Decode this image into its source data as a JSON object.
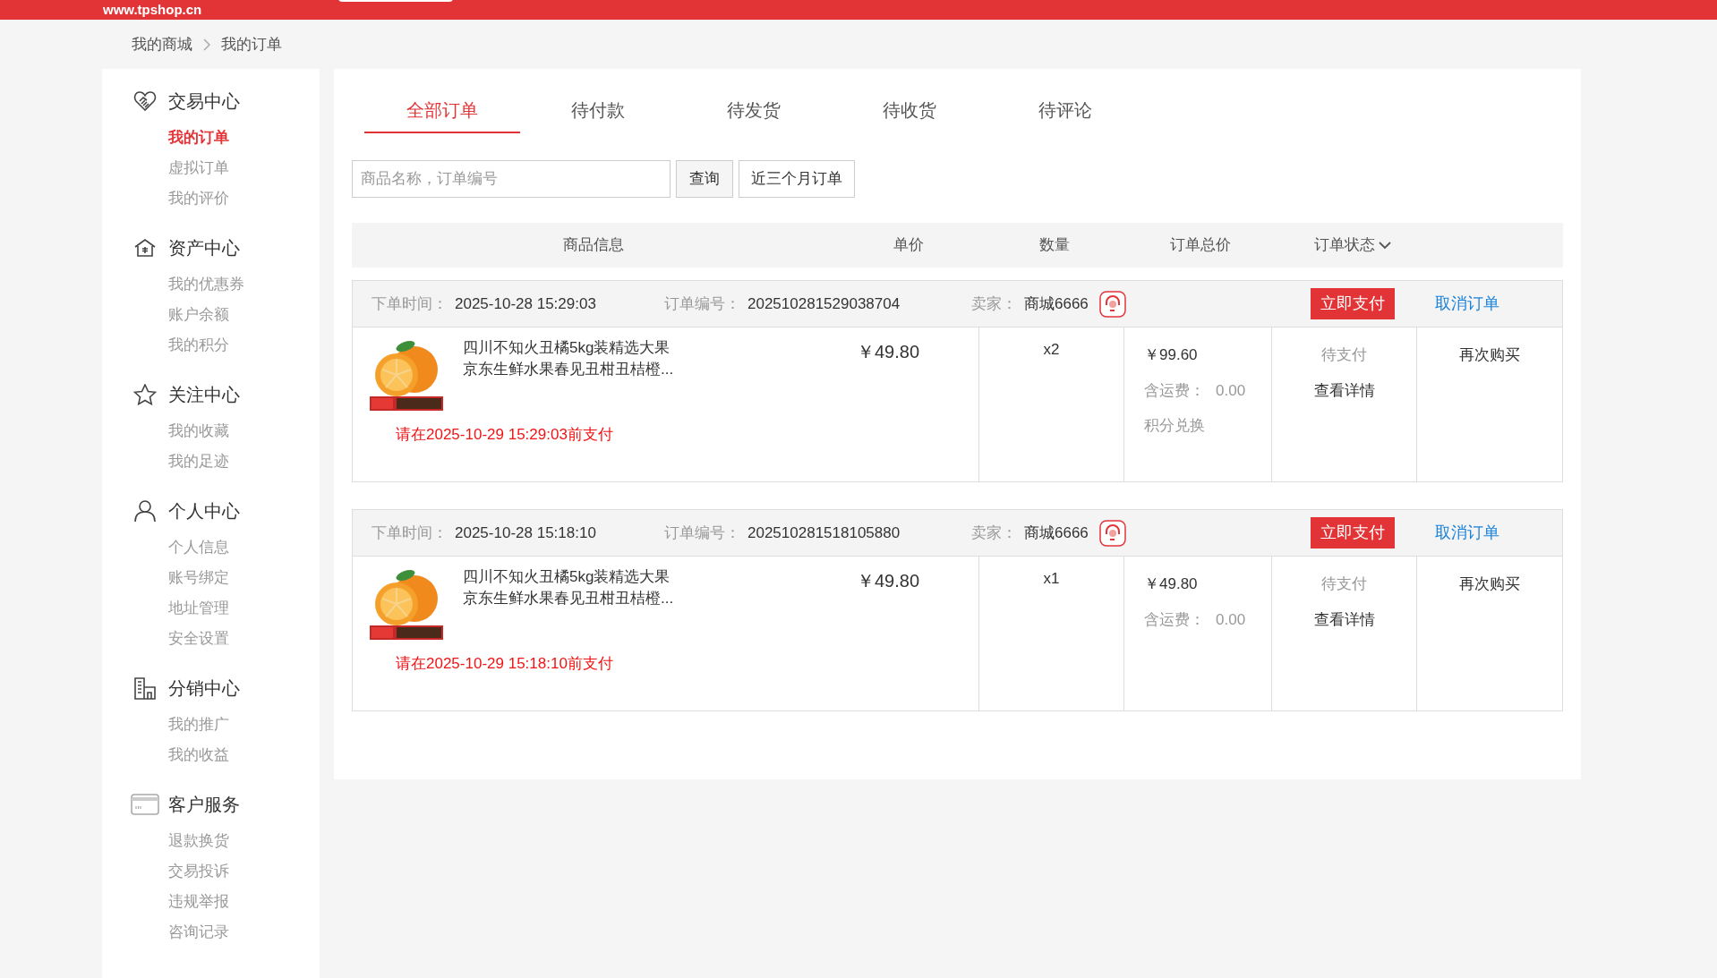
{
  "header": {
    "logo": "www.tpshop.cn"
  },
  "breadcrumb": [
    "我的商城",
    "我的订单"
  ],
  "sidebar": [
    {
      "title": "交易中心",
      "kind": "handshake",
      "items": [
        {
          "label": "我的订单",
          "selected": true
        },
        {
          "label": "虚拟订单",
          "selected": false
        },
        {
          "label": "我的评价",
          "selected": false
        }
      ]
    },
    {
      "title": "资产中心",
      "kind": "house",
      "items": [
        {
          "label": "我的优惠券",
          "selected": false
        },
        {
          "label": "账户余额",
          "selected": false
        },
        {
          "label": "我的积分",
          "selected": false
        }
      ]
    },
    {
      "title": "关注中心",
      "kind": "star",
      "items": [
        {
          "label": "我的收藏",
          "selected": false
        },
        {
          "label": "我的足迹",
          "selected": false
        }
      ]
    },
    {
      "title": "个人中心",
      "kind": "user",
      "items": [
        {
          "label": "个人信息",
          "selected": false
        },
        {
          "label": "账号绑定",
          "selected": false
        },
        {
          "label": "地址管理",
          "selected": false
        },
        {
          "label": "安全设置",
          "selected": false
        }
      ]
    },
    {
      "title": "分销中心",
      "kind": "building",
      "items": [
        {
          "label": "我的推广",
          "selected": false
        },
        {
          "label": "我的收益",
          "selected": false
        }
      ]
    },
    {
      "title": "客户服务",
      "kind": "card",
      "items": [
        {
          "label": "退款换货",
          "selected": false
        },
        {
          "label": "交易投诉",
          "selected": false
        },
        {
          "label": "违规举报",
          "selected": false
        },
        {
          "label": "咨询记录",
          "selected": false
        }
      ]
    }
  ],
  "tabs": [
    {
      "label": "全部订单",
      "selected": true
    },
    {
      "label": "待付款",
      "selected": false
    },
    {
      "label": "待发货",
      "selected": false
    },
    {
      "label": "待收货",
      "selected": false
    },
    {
      "label": "待评论",
      "selected": false
    }
  ],
  "search": {
    "placeholder": "商品名称，订单编号",
    "button": "查询",
    "filter": "近三个月订单"
  },
  "table": {
    "columns": [
      "商品信息",
      "单价",
      "数量",
      "订单总价",
      "订单状态"
    ]
  },
  "orders": [
    {
      "time_label": "下单时间：",
      "time": "2025-10-28 15:29:03",
      "no_label": "订单编号：",
      "no": "202510281529038704",
      "seller_label": "卖家：",
      "seller": "商城6666",
      "pay": "立即支付",
      "cancel": "取消订单",
      "product": [
        "四川不知火丑橘5kg装精选大果",
        "京东生鲜水果春见丑柑丑桔橙..."
      ],
      "deadline": "请在2025-10-29 15:29:03前支付",
      "price": "￥49.80",
      "qty": "x2",
      "total": "￥99.60",
      "shipping_label": "含运费：",
      "shipping": "0.00",
      "extra": "积分兑换",
      "status": "待支付",
      "details": "查看详情",
      "rebuy": "再次购买"
    },
    {
      "time_label": "下单时间：",
      "time": "2025-10-28 15:18:10",
      "no_label": "订单编号：",
      "no": "202510281518105880",
      "seller_label": "卖家：",
      "seller": "商城6666",
      "pay": "立即支付",
      "cancel": "取消订单",
      "product": [
        "四川不知火丑橘5kg装精选大果",
        "京东生鲜水果春见丑柑丑桔橙..."
      ],
      "deadline": "请在2025-10-29 15:18:10前支付",
      "price": "￥49.80",
      "qty": "x1",
      "total": "￥49.80",
      "shipping_label": "含运费：",
      "shipping": "0.00",
      "status": "待支付",
      "details": "查看详情",
      "rebuy": "再次购买"
    }
  ]
}
